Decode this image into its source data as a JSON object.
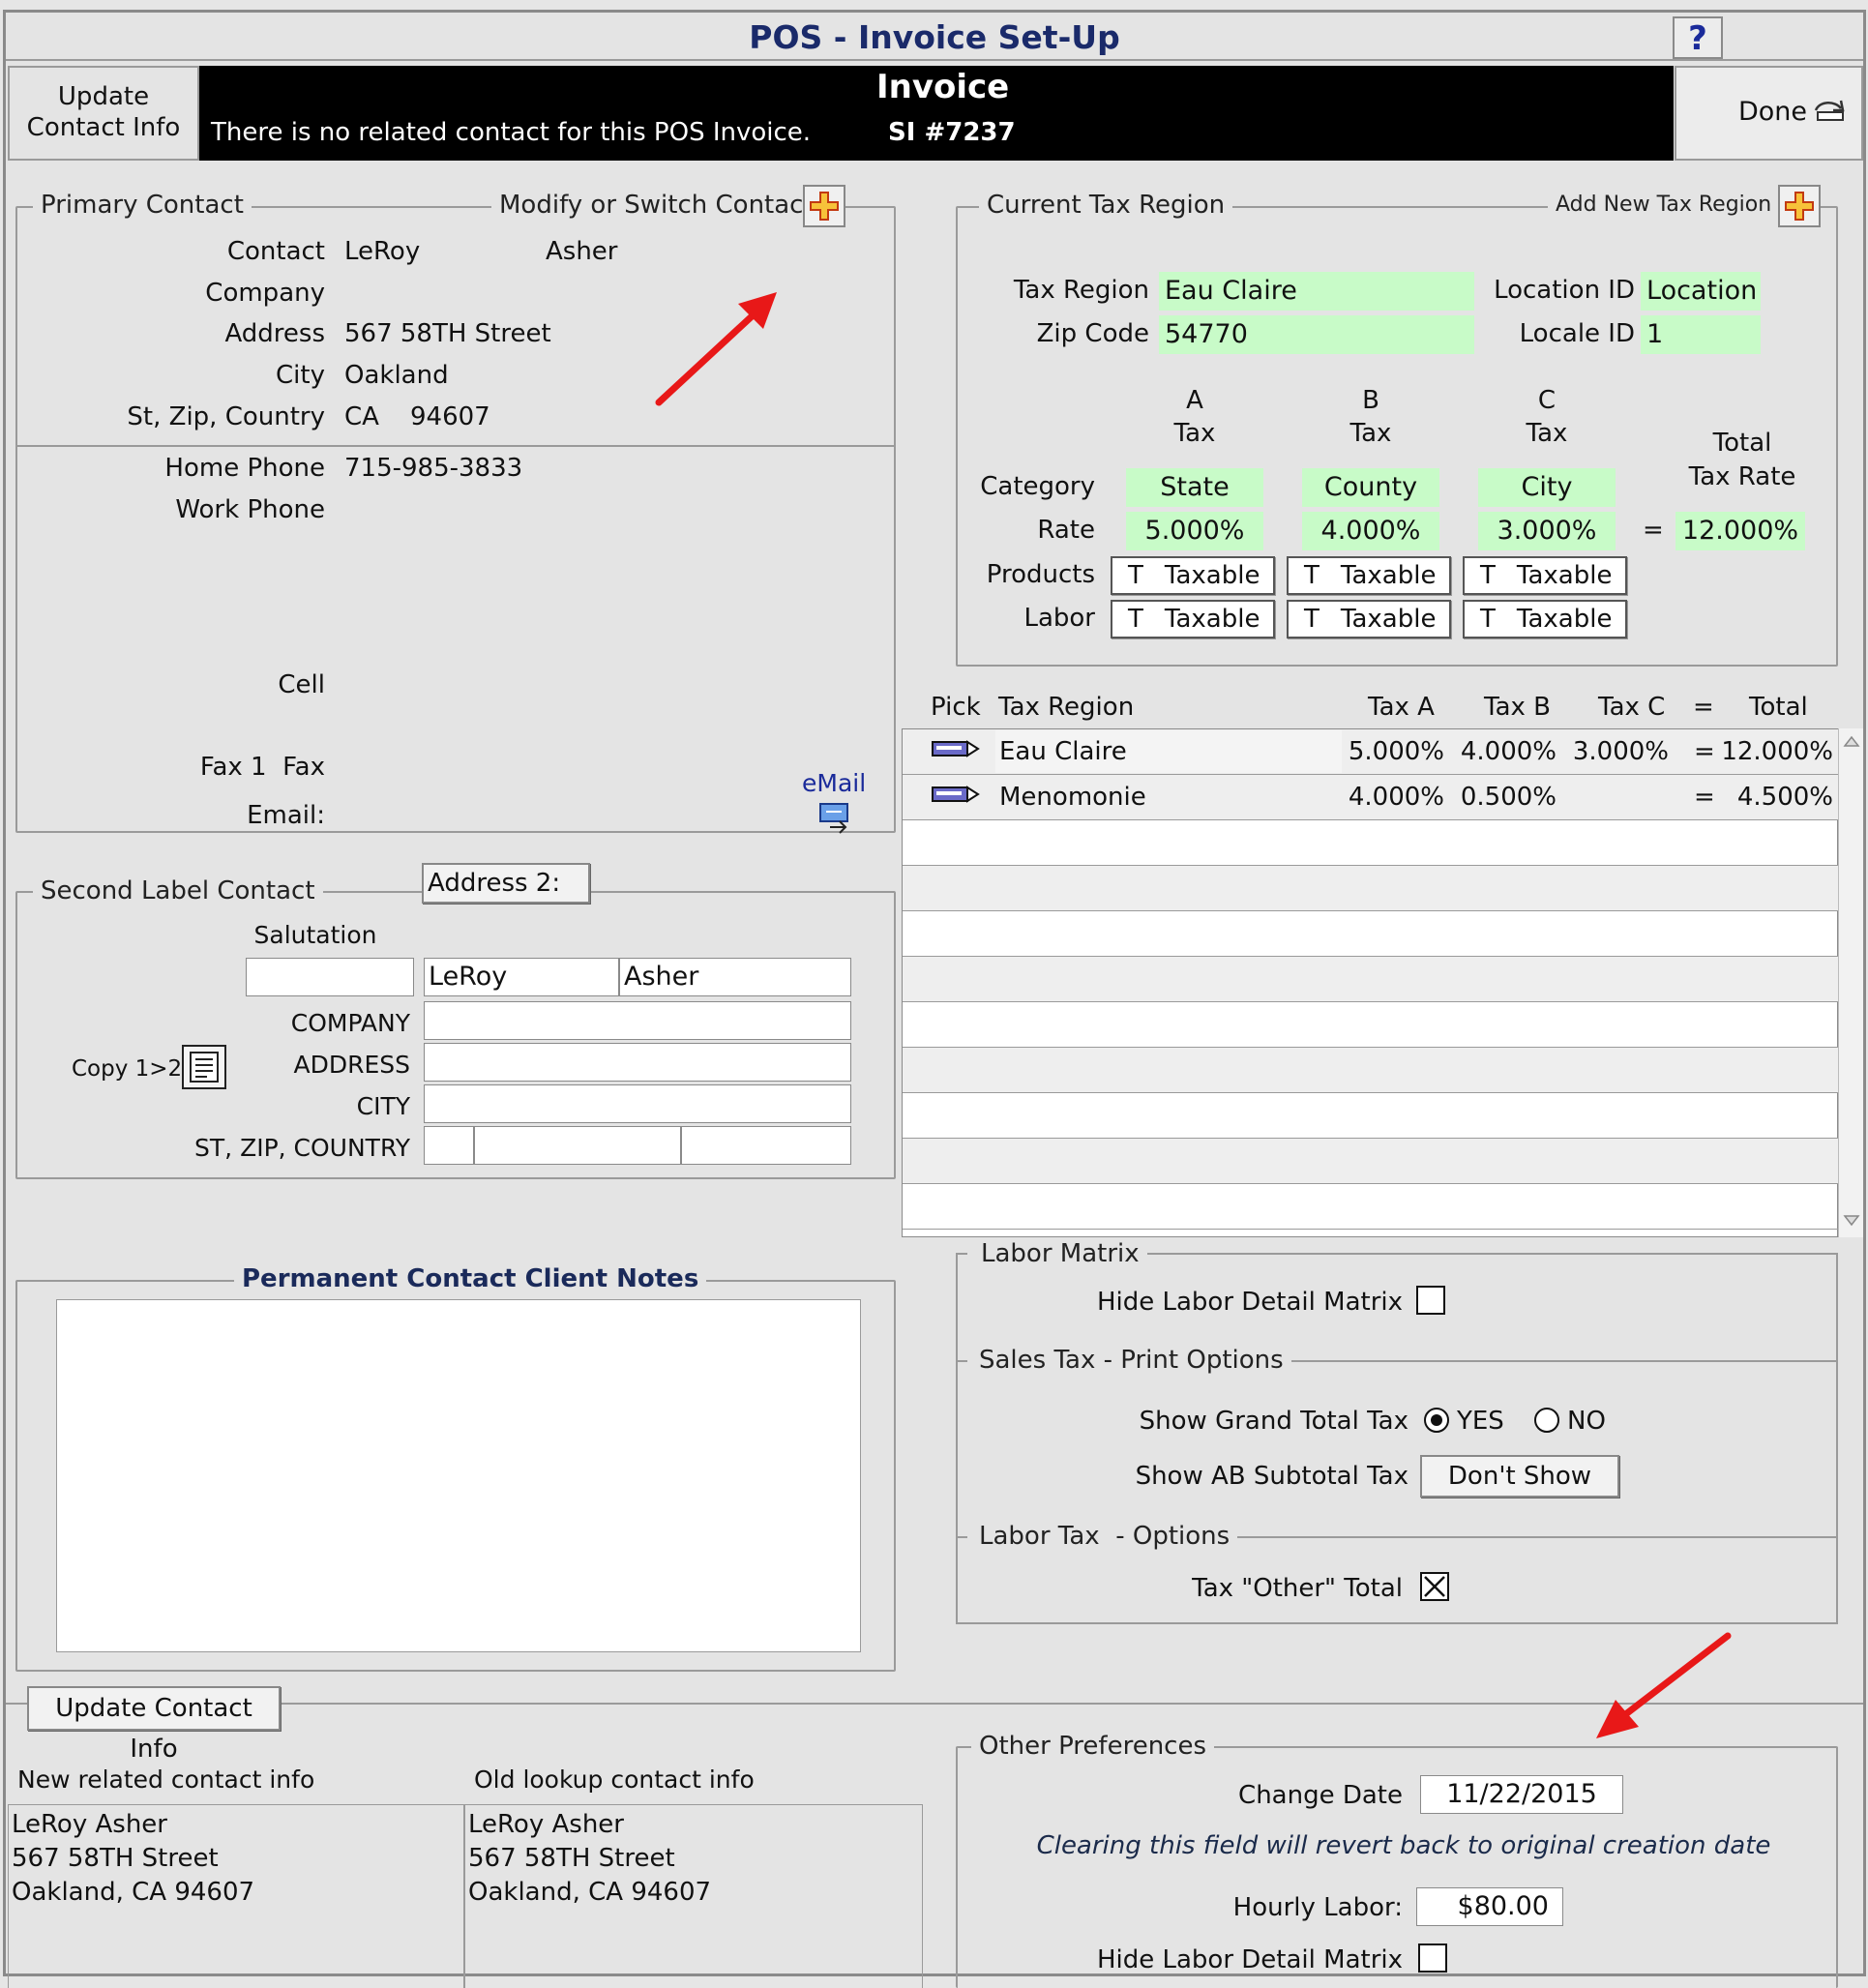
{
  "window": {
    "title": "POS - Invoice Set-Up",
    "help_label": "?"
  },
  "header": {
    "update_contact_label": "Update\nContact Info",
    "invoice_title": "Invoice",
    "no_contact_msg": "There is no related contact for this POS Invoice.",
    "invoice_number": "SI #7237",
    "done_label": "Done"
  },
  "primary_contact": {
    "legend": "Primary Contact",
    "modify_label": "Modify or Switch Contact",
    "labels": {
      "contact": "Contact",
      "company": "Company",
      "address": "Address",
      "city": "City",
      "st_zip_country": "St, Zip, Country",
      "home_phone": "Home Phone",
      "work_phone": "Work Phone",
      "cell": "Cell",
      "fax": "Fax 1  Fax",
      "email": "Email:",
      "email_btn": "eMail"
    },
    "values": {
      "first_name": "LeRoy",
      "last_name": "Asher",
      "company": "",
      "address": "567 58TH Street",
      "city": "Oakland",
      "state": "CA",
      "zip": "94607",
      "home_phone": "715-985-3833"
    }
  },
  "second_contact": {
    "legend": "Second Label Contact",
    "address2_label": "Address 2:",
    "salutation_label": "Salutation",
    "salutation_value": "",
    "first_name": "LeRoy",
    "last_name": "Asher",
    "labels": {
      "company": "COMPANY",
      "address": "ADDRESS",
      "city": "CITY",
      "st_zip_country": "ST, ZIP, COUNTRY"
    },
    "copy_label": "Copy 1>2"
  },
  "notes": {
    "legend": "Permanent Contact Client Notes",
    "value": ""
  },
  "update_contact": {
    "button_label": "Update Contact Info",
    "new_label": "New related contact info",
    "old_label": "Old lookup contact info",
    "new_lines": [
      "LeRoy Asher",
      "567 58TH Street",
      "Oakland, CA 94607"
    ],
    "old_lines": [
      "LeRoy Asher",
      "567 58TH Street",
      "Oakland, CA 94607"
    ]
  },
  "tax_region": {
    "legend": "Current Tax Region",
    "add_label": "Add New Tax Region",
    "tax_region_label": "Tax Region",
    "tax_region_value": "Eau Claire",
    "zip_label": "Zip Code",
    "zip_value": "54770",
    "location_label": "Location ID",
    "location_value": "Location",
    "locale_label": "Locale ID",
    "locale_value": "1",
    "col_heads": [
      [
        "A",
        "Tax"
      ],
      [
        "B",
        "Tax"
      ],
      [
        "C",
        "Tax"
      ]
    ],
    "total_head": [
      "Total",
      "Tax Rate"
    ],
    "category_label": "Category",
    "rate_label": "Rate",
    "products_label": "Products",
    "labor_label": "Labor",
    "categories": [
      "State",
      "County",
      "City"
    ],
    "rates": [
      "5.000%",
      "4.000%",
      "3.000%"
    ],
    "equals": "=",
    "total_rate": "12.000%",
    "taxable_prefix": "T",
    "taxable_label": "Taxable"
  },
  "region_list": {
    "headers": {
      "pick": "Pick",
      "region": "Tax Region",
      "a": "Tax A",
      "b": "Tax B",
      "c": "Tax C",
      "eq": "=",
      "total": "Total"
    },
    "rows": [
      {
        "name": "Eau Claire",
        "a": "5.000%",
        "b": "4.000%",
        "c": "3.000%",
        "eq": "=",
        "total": "12.000%"
      },
      {
        "name": "Menomonie",
        "a": "4.000%",
        "b": "0.500%",
        "c": "",
        "eq": "=",
        "total": "4.500%"
      }
    ]
  },
  "labor_matrix": {
    "legend": "Labor Matrix",
    "hide_label": "Hide Labor Detail Matrix"
  },
  "sales_tax": {
    "legend": "Sales Tax - Print Options",
    "grand_total_label": "Show Grand Total Tax",
    "yes": "YES",
    "no": "NO",
    "ab_subtotal_label": "Show AB Subtotal Tax",
    "ab_subtotal_value": "Don't Show"
  },
  "labor_tax": {
    "legend": "Labor Tax  - Options",
    "other_total_label": "Tax \"Other\" Total"
  },
  "other_prefs": {
    "legend": "Other Preferences",
    "change_date_label": "Change Date",
    "change_date_value": "11/22/2015",
    "note": "Clearing this field will revert back to original creation date",
    "hourly_label": "Hourly Labor:",
    "hourly_value": "$80.00",
    "hide_label": "Hide Labor Detail Matrix"
  },
  "colors": {
    "accent_arrow": "#e81818",
    "field_green": "#c8fbc8",
    "title_blue": "#1a2a6a"
  }
}
